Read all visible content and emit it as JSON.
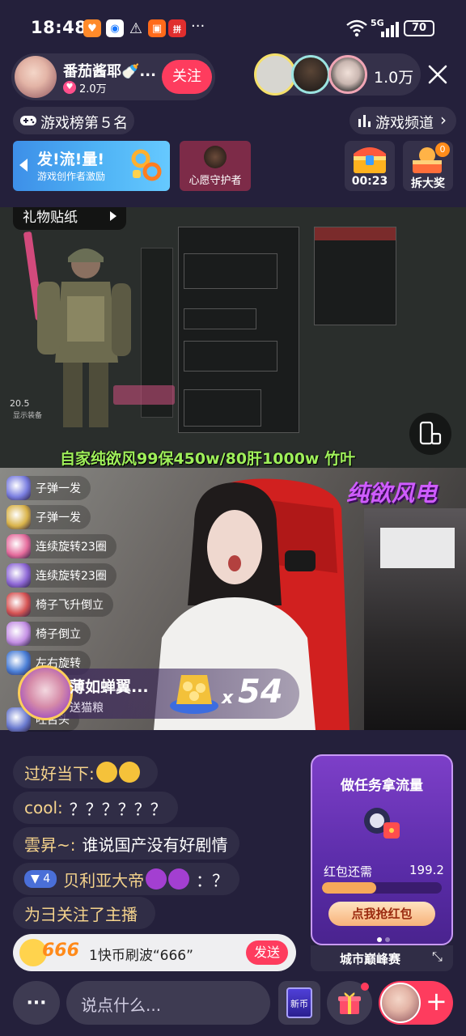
{
  "status_bar": {
    "time": "18:48",
    "more": "···",
    "network": "5G",
    "battery": "70",
    "icons": [
      "taobao-icon",
      "alipay-icon",
      "warning-icon",
      "app-icon",
      "pinduoduo-icon"
    ]
  },
  "streamer": {
    "name": "番茄酱耶🍼...",
    "fans": "2.0万",
    "follow_label": "关注"
  },
  "viewers": {
    "count": "1.0万"
  },
  "ranking": {
    "label": "游戏榜第５名",
    "channel_label": "游戏频道"
  },
  "promo": {
    "banner_title": "发!流!量!",
    "banner_subtitle": "游戏创作者激励",
    "guardian_label": "心愿守护者",
    "chest_timer": "00:23",
    "big_prize_label": "拆大奖",
    "big_prize_badge": "0"
  },
  "game_screen": {
    "sticker_label": "礼物贴纸",
    "caption": "自家纯欲风99保450w/80肝1000w  竹叶",
    "hud_health": "20.5",
    "tabs_hint": "显示装备"
  },
  "cam_screen": {
    "watermark": "纯欲风电"
  },
  "gift_list": [
    {
      "name": "子弹一发",
      "color": "#7a7ee0"
    },
    {
      "name": "子弹一发",
      "color": "#d9b34a"
    },
    {
      "name": "连续旋转23圈",
      "color": "#e56c9c"
    },
    {
      "name": "连续旋转23圈",
      "color": "#8e68d6"
    },
    {
      "name": "椅子飞升倒立",
      "color": "#d65454"
    },
    {
      "name": "椅子倒立",
      "color": "#c490e4"
    },
    {
      "name": "左右旋转",
      "color": "#4a7ed6"
    },
    {
      "name": "吐舌头",
      "color": "#6b7bd0"
    }
  ],
  "gift_combo": {
    "sender": "薄如蝉翼...",
    "gift_name": "送猫粮",
    "multiplier": "x",
    "count": "54"
  },
  "chat": [
    {
      "user": "过好当下:",
      "text": "",
      "emoji": [
        "😭",
        "😭"
      ]
    },
    {
      "user": "cool:",
      "text": "？？？？？？",
      "emoji": []
    },
    {
      "user": "雲昇~:",
      "text": "谁说国产没有好剧情",
      "emoji": []
    },
    {
      "user": "贝利亚大帝",
      "level": "4",
      "text": "：？",
      "emoji": [
        "👿",
        "👿"
      ]
    },
    {
      "user": "为彐关注了主播",
      "text": "",
      "emoji": []
    }
  ],
  "task_card": {
    "title": "做任务拿流量",
    "redpacket_label": "红包还需",
    "redpacket_value": "199.2",
    "progress": 0.45,
    "cta_label": "点我抢红包",
    "footer_label": "城市巅峰赛"
  },
  "quick_send": {
    "badge": "666",
    "text": "1快币刷波“666”",
    "send_label": "发送"
  },
  "bottom_bar": {
    "more_label": "···",
    "input_placeholder": "说点什么...",
    "card_label": "新币"
  },
  "colors": {
    "accent": "#fe3c5e",
    "bg": "#24203b",
    "username": "#f5d38c"
  }
}
